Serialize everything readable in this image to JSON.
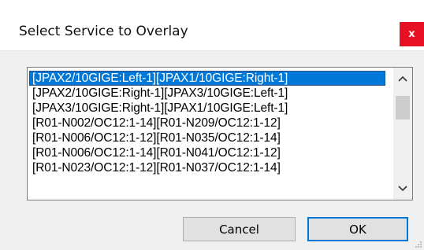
{
  "window": {
    "title": "Select Service to Overlay",
    "close_glyph": "x",
    "accent": "#e81123"
  },
  "list": {
    "selection_color": "#0078d7",
    "items": [
      "[JPAX2/10GIGE:Left-1][JPAX1/10GIGE:Right-1]",
      "[JPAX2/10GIGE:Right-1][JPAX3/10GIGE:Left-1]",
      "[JPAX3/10GIGE:Right-1][JPAX1/10GIGE:Left-1]",
      "[R01-N002/OC12:1-14][R01-N209/OC12:1-12]",
      "[R01-N006/OC12:1-12][R01-N035/OC12:1-14]",
      "[R01-N006/OC12:1-14][R01-N041/OC12:1-12]",
      "[R01-N023/OC12:1-12][R01-N037/OC12:1-14]"
    ],
    "selected_index": 0,
    "scroll_up_icon": "chevron-up-icon",
    "scroll_down_icon": "chevron-down-icon"
  },
  "buttons": {
    "cancel_label": "Cancel",
    "ok_label": "OK"
  }
}
